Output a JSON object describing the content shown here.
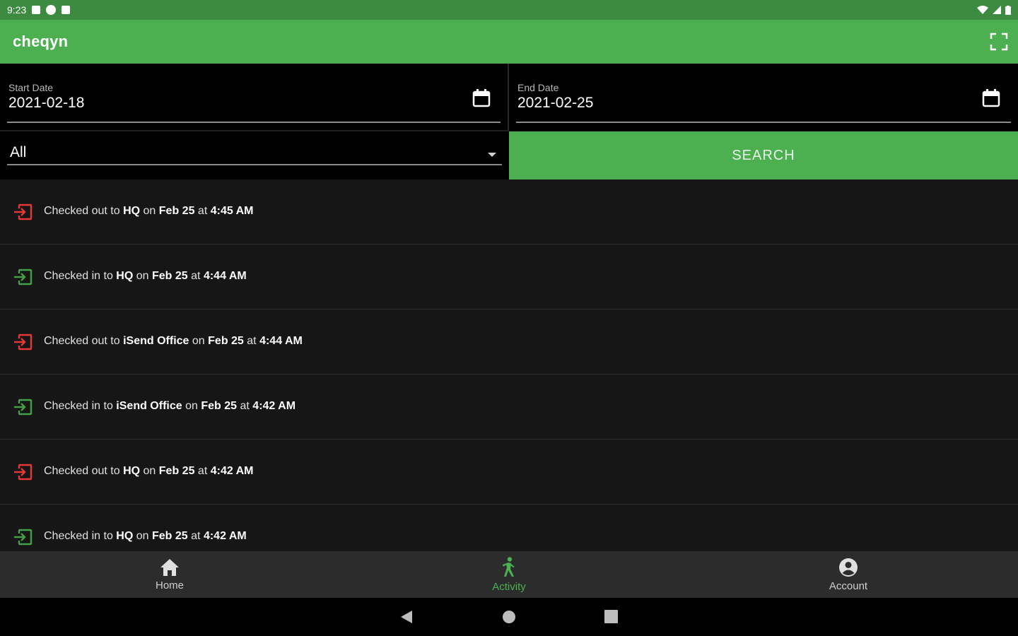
{
  "status_bar": {
    "time": "9:23"
  },
  "app_bar": {
    "title": "cheqyn"
  },
  "filters": {
    "start_date": {
      "label": "Start Date",
      "value": "2021-02-18"
    },
    "end_date": {
      "label": "End Date",
      "value": "2021-02-25"
    },
    "type_select": {
      "value": "All"
    },
    "search_label": "SEARCH"
  },
  "activity": [
    {
      "kind": "out",
      "action": "Checked out to",
      "place": "HQ",
      "on": "on",
      "date": "Feb 25",
      "at": "at",
      "time": "4:45 AM"
    },
    {
      "kind": "in",
      "action": "Checked in to",
      "place": "HQ",
      "on": "on",
      "date": "Feb 25",
      "at": "at",
      "time": "4:44 AM"
    },
    {
      "kind": "out",
      "action": "Checked out to",
      "place": "iSend Office",
      "on": "on",
      "date": "Feb 25",
      "at": "at",
      "time": "4:44 AM"
    },
    {
      "kind": "in",
      "action": "Checked in to",
      "place": "iSend Office",
      "on": "on",
      "date": "Feb 25",
      "at": "at",
      "time": "4:42 AM"
    },
    {
      "kind": "out",
      "action": "Checked out to",
      "place": "HQ",
      "on": "on",
      "date": "Feb 25",
      "at": "at",
      "time": "4:42 AM"
    },
    {
      "kind": "in",
      "action": "Checked in to",
      "place": "HQ",
      "on": "on",
      "date": "Feb 25",
      "at": "at",
      "time": "4:42 AM"
    }
  ],
  "bottom_nav": [
    {
      "label": "Home",
      "icon": "home-icon",
      "active": false
    },
    {
      "label": "Activity",
      "icon": "walk-icon",
      "active": true
    },
    {
      "label": "Account",
      "icon": "account-circle-icon",
      "active": false
    }
  ],
  "colors": {
    "primary": "#4caf50",
    "status_bar": "#3d8b40",
    "checkout": "#e53935",
    "checkin": "#43a047",
    "background": "#161616"
  }
}
